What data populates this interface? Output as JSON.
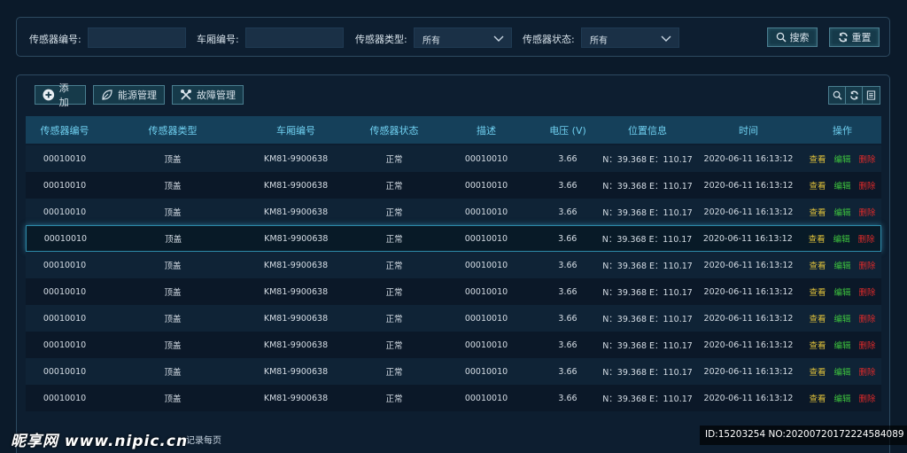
{
  "filters": {
    "sensor_id_label": "传感器编号:",
    "car_id_label": "车厢编号:",
    "sensor_type_label": "传感器类型:",
    "sensor_type_value": "所有",
    "sensor_status_label": "传感器状态:",
    "sensor_status_value": "所有",
    "search_label": "搜索",
    "reset_label": "重置"
  },
  "toolbar": {
    "add_label": "添加",
    "energy_label": "能源管理",
    "fault_label": "故障管理"
  },
  "table": {
    "headers": [
      "传感器编号",
      "传感器类型",
      "车厢编号",
      "传感器状态",
      "描述",
      "电压 (V)",
      "位置信息",
      "时间",
      "操作"
    ],
    "rows": [
      {
        "sensor_id": "00010010",
        "type": "顶盖",
        "car_id": "KM81-9900638",
        "status": "正常",
        "desc": "00010010",
        "voltage": "3.66",
        "position": "N：39.368 E：110.17",
        "time": "2020-06-11 16:13:12",
        "view": "查看",
        "edit": "编辑",
        "delete": "删除"
      },
      {
        "sensor_id": "00010010",
        "type": "顶盖",
        "car_id": "KM81-9900638",
        "status": "正常",
        "desc": "00010010",
        "voltage": "3.66",
        "position": "N：39.368 E：110.17",
        "time": "2020-06-11 16:13:12",
        "view": "查看",
        "edit": "编辑",
        "delete": "删除"
      },
      {
        "sensor_id": "00010010",
        "type": "顶盖",
        "car_id": "KM81-9900638",
        "status": "正常",
        "desc": "00010010",
        "voltage": "3.66",
        "position": "N：39.368 E：110.17",
        "time": "2020-06-11 16:13:12",
        "view": "查看",
        "edit": "编辑",
        "delete": "删除"
      },
      {
        "sensor_id": "00010010",
        "type": "顶盖",
        "car_id": "KM81-9900638",
        "status": "正常",
        "desc": "00010010",
        "voltage": "3.66",
        "position": "N：39.368 E：110.17",
        "time": "2020-06-11 16:13:12",
        "view": "查看",
        "edit": "编辑",
        "delete": "删除"
      },
      {
        "sensor_id": "00010010",
        "type": "顶盖",
        "car_id": "KM81-9900638",
        "status": "正常",
        "desc": "00010010",
        "voltage": "3.66",
        "position": "N：39.368 E：110.17",
        "time": "2020-06-11 16:13:12",
        "view": "查看",
        "edit": "编辑",
        "delete": "删除"
      },
      {
        "sensor_id": "00010010",
        "type": "顶盖",
        "car_id": "KM81-9900638",
        "status": "正常",
        "desc": "00010010",
        "voltage": "3.66",
        "position": "N：39.368 E：110.17",
        "time": "2020-06-11 16:13:12",
        "view": "查看",
        "edit": "编辑",
        "delete": "删除"
      },
      {
        "sensor_id": "00010010",
        "type": "顶盖",
        "car_id": "KM81-9900638",
        "status": "正常",
        "desc": "00010010",
        "voltage": "3.66",
        "position": "N：39.368 E：110.17",
        "time": "2020-06-11 16:13:12",
        "view": "查看",
        "edit": "编辑",
        "delete": "删除"
      },
      {
        "sensor_id": "00010010",
        "type": "顶盖",
        "car_id": "KM81-9900638",
        "status": "正常",
        "desc": "00010010",
        "voltage": "3.66",
        "position": "N：39.368 E：110.17",
        "time": "2020-06-11 16:13:12",
        "view": "查看",
        "edit": "编辑",
        "delete": "删除"
      },
      {
        "sensor_id": "00010010",
        "type": "顶盖",
        "car_id": "KM81-9900638",
        "status": "正常",
        "desc": "00010010",
        "voltage": "3.66",
        "position": "N：39.368 E：110.17",
        "time": "2020-06-11 16:13:12",
        "view": "查看",
        "edit": "编辑",
        "delete": "删除"
      },
      {
        "sensor_id": "00010010",
        "type": "顶盖",
        "car_id": "KM81-9900638",
        "status": "正常",
        "desc": "00010010",
        "voltage": "3.66",
        "position": "N：39.368 E：110.17",
        "time": "2020-06-11 16:13:12",
        "view": "查看",
        "edit": "编辑",
        "delete": "删除"
      }
    ]
  },
  "footer": {
    "page_text": "记录每页"
  },
  "watermark": {
    "left": "昵享网 www.nipic.cn",
    "right": "ID:15203254 NO:20200720172224584089"
  },
  "colors": {
    "background": "#0b1a2a",
    "header_text": "#6fd0f0",
    "view": "#e0c23a",
    "edit": "#3ec43e",
    "delete": "#e02a2a"
  }
}
